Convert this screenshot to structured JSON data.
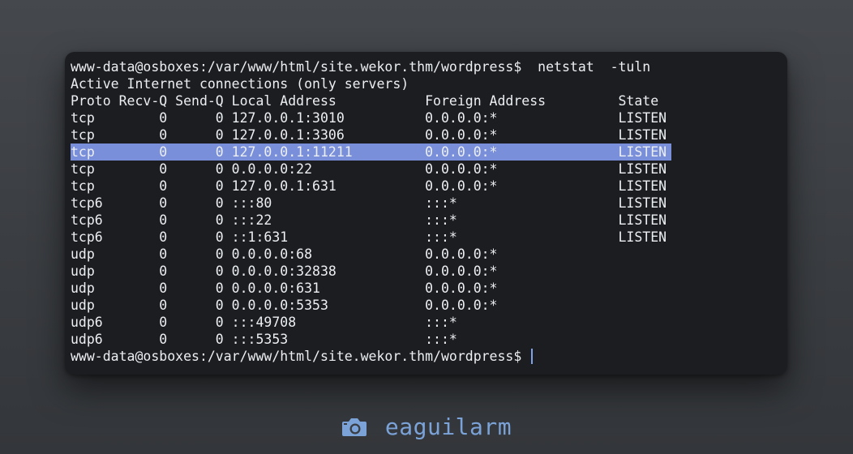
{
  "terminal": {
    "lines": [
      "www-data@osboxes:/var/www/html/site.wekor.thm/wordpress$  netstat  -tuln",
      "Active Internet connections (only servers)",
      "Proto Recv-Q Send-Q Local Address           Foreign Address         State",
      "tcp        0      0 127.0.0.1:3010          0.0.0.0:*               LISTEN",
      "tcp        0      0 127.0.0.1:3306          0.0.0.0:*               LISTEN",
      "tcp        0      0 127.0.0.1:11211         0.0.0.0:*               LISTEN",
      "tcp        0      0 0.0.0.0:22              0.0.0.0:*               LISTEN",
      "tcp        0      0 127.0.0.1:631           0.0.0.0:*               LISTEN",
      "tcp6       0      0 :::80                   :::*                    LISTEN",
      "tcp6       0      0 :::22                   :::*                    LISTEN",
      "tcp6       0      0 ::1:631                 :::*                    LISTEN",
      "udp        0      0 0.0.0.0:68              0.0.0.0:*",
      "udp        0      0 0.0.0.0:32838           0.0.0.0:*",
      "udp        0      0 0.0.0.0:631             0.0.0.0:*",
      "udp        0      0 0.0.0.0:5353            0.0.0.0:*",
      "udp6       0      0 :::49708                :::*",
      "udp6       0      0 :::5353                 :::*",
      "www-data@osboxes:/var/www/html/site.wekor.thm/wordpress$ "
    ],
    "highlighted_line_index": 5,
    "colors": {
      "background": "#1c1d21",
      "text": "#eceff2",
      "selection": "#7a8fd9",
      "cursor": "#7fa2e8"
    }
  },
  "footer": {
    "icon": "camera-icon",
    "author": "eaguilarm",
    "color": "#7ba3d8"
  }
}
